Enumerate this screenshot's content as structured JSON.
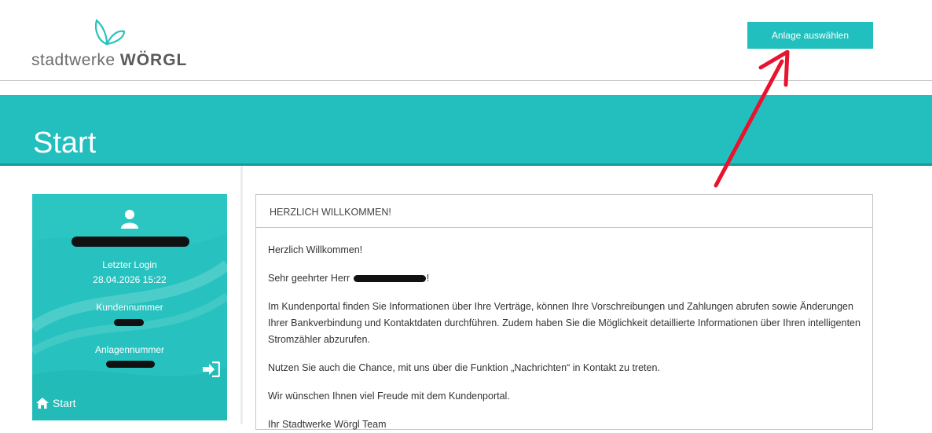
{
  "header": {
    "logo": {
      "prefix": "stadtwerke",
      "brand": "WÖRGL"
    },
    "anlage_button": "Anlage auswählen"
  },
  "banner": {
    "title": "Start"
  },
  "profile": {
    "last_login_label": "Letzter Login",
    "last_login_value": "28.04.2026 15:22",
    "kundennummer_label": "Kundennummer",
    "anlagennummer_label": "Anlagennummer",
    "start_link": "Start"
  },
  "welcome_card": {
    "title": "HERZLICH WILLKOMMEN!",
    "greeting": "Herzlich Willkommen!",
    "salutation": "Sehr geehrter Herr",
    "salutation_end": "!",
    "paragraph1": "Im Kundenportal finden Sie Informationen über Ihre Verträge, können Ihre Vorschreibungen und Zahlungen abrufen sowie Änderungen Ihrer Bankverbindung und Kontaktdaten durchführen. Zudem haben Sie die Möglichkeit detaillierte Informationen über Ihren intelligenten Stromzähler abzurufen.",
    "paragraph2": "Nutzen Sie auch die Chance, mit uns über die Funktion „Nachrichten“ in Kontakt zu treten.",
    "paragraph3": "Wir wünschen Ihnen viel Freude mit dem Kundenportal.",
    "signature": "Ihr Stadtwerke Wörgl Team"
  },
  "colors": {
    "accent": "#23bfbf",
    "annotation_arrow": "#e8132e"
  }
}
